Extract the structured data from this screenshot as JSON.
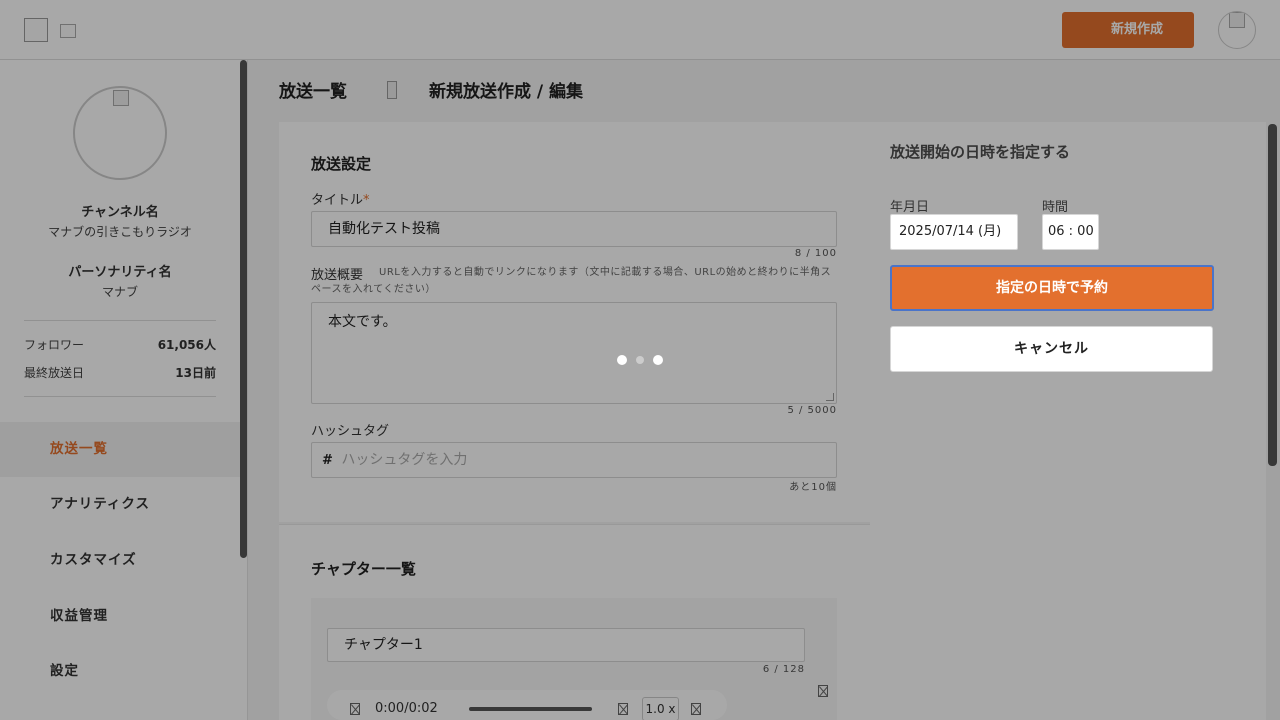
{
  "header": {
    "new_button_label": "新規作成"
  },
  "sidebar": {
    "channel_label": "チャンネル名",
    "channel_name": "マナブの引きこもりラジオ",
    "personality_label": "パーソナリティ名",
    "personality_name": "マナブ",
    "stats": [
      {
        "label": "フォロワー",
        "value": "61,056人"
      },
      {
        "label": "最終放送日",
        "value": "13日前"
      }
    ],
    "nav": [
      {
        "label": "放送一覧",
        "active": true
      },
      {
        "label": "アナリティクス"
      },
      {
        "label": "カスタマイズ"
      },
      {
        "label": "収益管理"
      },
      {
        "label": "設定"
      }
    ]
  },
  "breadcrumb": {
    "item1": "放送一覧",
    "item2": "新規放送作成 / 編集"
  },
  "broadcast_settings": {
    "heading": "放送設定",
    "title_label": "タイトル",
    "title_required_mark": "*",
    "title_value": "自動化テスト投稿",
    "title_counter": "8 / 100",
    "summary_label": "放送概要",
    "summary_hint": "URLを入力すると自動でリンクになります（文中に記載する場合、URLの始めと終わりに半角スペースを入れてください）",
    "summary_value": "本文です。",
    "summary_counter": "5 / 5000",
    "hashtag_label": "ハッシュタグ",
    "hashtag_prefix": "#",
    "hashtag_placeholder": "ハッシュタグを入力",
    "hashtag_counter": "あと10個"
  },
  "chapters": {
    "heading": "チャプター一覧",
    "chapter1_value": "チャプター1",
    "chapter1_counter": "6 / 128",
    "time": "0:00/0:02",
    "speed": "1.0 x"
  },
  "schedule": {
    "heading": "放送開始の日時を指定する",
    "date_label": "年月日",
    "date_value": "2025/07/14 (月)",
    "time_label": "時間",
    "time_value": "06 : 00",
    "reserve_button": "指定の日時で予約",
    "cancel_button": "キャンセル"
  },
  "colors": {
    "accent": "#e3702e",
    "focus_border": "#4a74c9",
    "overlay": "rgba(0,0,0,0.34)"
  }
}
